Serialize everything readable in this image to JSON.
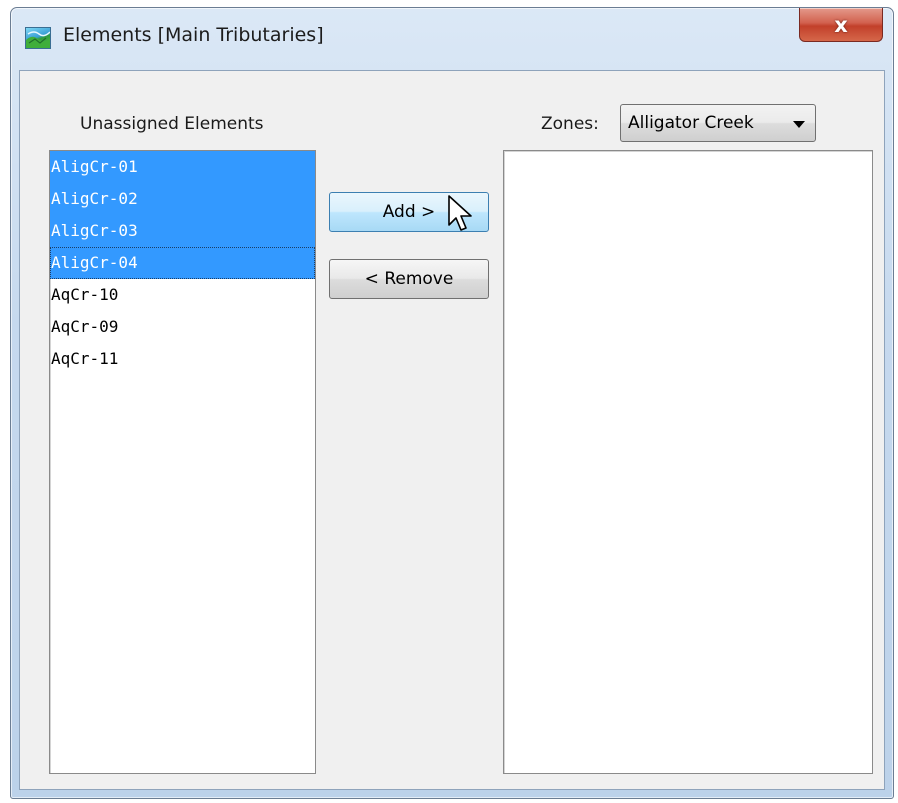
{
  "window": {
    "title": "Elements [Main Tributaries]",
    "close_label": "x"
  },
  "unassigned": {
    "label": "Unassigned Elements",
    "items": [
      {
        "label": "AligCr-01",
        "selected": true
      },
      {
        "label": "AligCr-02",
        "selected": true
      },
      {
        "label": "AligCr-03",
        "selected": true
      },
      {
        "label": "AligCr-04",
        "selected": true
      },
      {
        "label": "AqCr-10",
        "selected": false
      },
      {
        "label": "AqCr-09",
        "selected": false
      },
      {
        "label": "AqCr-11",
        "selected": false
      }
    ]
  },
  "buttons": {
    "add_label": "Add >",
    "remove_label": "< Remove"
  },
  "zones": {
    "label": "Zones:",
    "selected": "Alligator Creek"
  },
  "colors": {
    "selection": "#3399ff",
    "close_button": "#c7432d"
  }
}
